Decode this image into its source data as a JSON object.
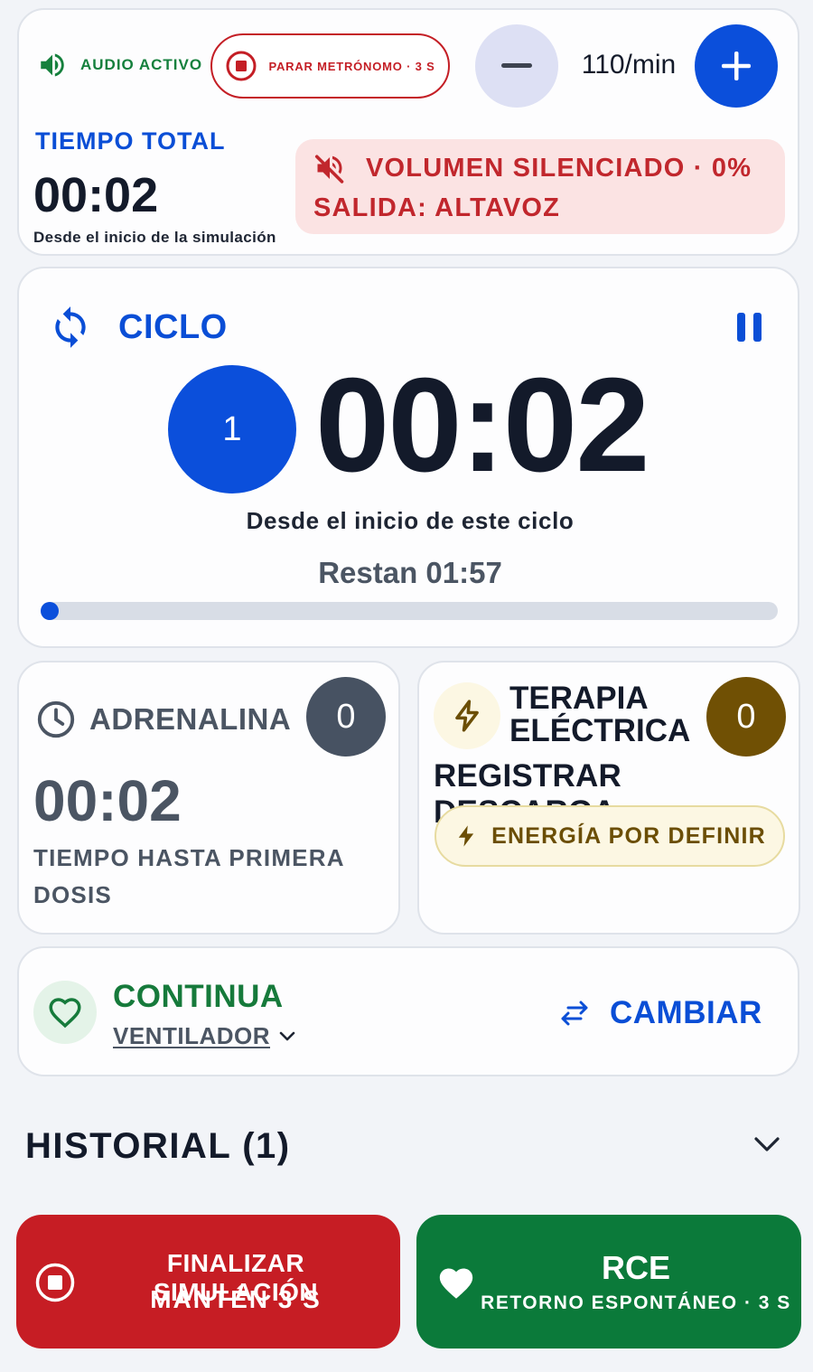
{
  "top_bar": {
    "audio_label": "AUDIO ACTIVO",
    "stop_metronome_label": "PARAR METRÓNOMO · 3 S",
    "bpm_value": "110/min",
    "total_time_label": "TIEMPO TOTAL",
    "total_time_value": "00:02",
    "total_time_sub": "Desde el inicio de la simulación",
    "mute_warning_line1": "VOLUMEN SILENCIADO · 0%",
    "mute_warning_line2": "SALIDA: ALTAVOZ"
  },
  "cycle": {
    "title": "CICLO",
    "number": "1",
    "time": "00:02",
    "subtitle": "Desde el inicio de este ciclo",
    "remaining": "Restan 01:57",
    "progress_fraction": 0.017
  },
  "adrenaline": {
    "title": "ADRENALINA",
    "count": "0",
    "time": "00:02",
    "subtitle": "TIEMPO HASTA PRIMERA DOSIS"
  },
  "electric_therapy": {
    "title_line1": "TERAPIA",
    "title_line2": "ELÉCTRICA",
    "count": "0",
    "action": "REGISTRAR DESCARGA",
    "energy_label": "ENERGÍA POR DEFINIR"
  },
  "rhythm": {
    "name": "CONTINUA",
    "device": "VENTILADOR",
    "change_label": "CAMBIAR"
  },
  "history": {
    "title": "HISTORIAL (1)"
  },
  "actions": {
    "end_line1": "FINALIZAR SIMULACIÓN",
    "end_line2": "MANTÉN 3 S",
    "rce_line1": "RCE",
    "rce_line2": "RETORNO ESPONTÁNEO · 3 S"
  },
  "colors": {
    "primary_blue": "#0b4fdb",
    "alert_red": "#c61d24",
    "success_green": "#0b7a3a",
    "shock_brown": "#705004",
    "neutral_slate": "#475262"
  },
  "icons": [
    "speaker-icon",
    "stop-circle-icon",
    "minus-icon",
    "plus-icon",
    "muted-speaker-icon",
    "sync-icon",
    "pause-icon",
    "clock-icon",
    "bolt-icon",
    "heart-outline-icon",
    "chevron-down-icon",
    "swap-arrows-icon",
    "heart-icon"
  ]
}
